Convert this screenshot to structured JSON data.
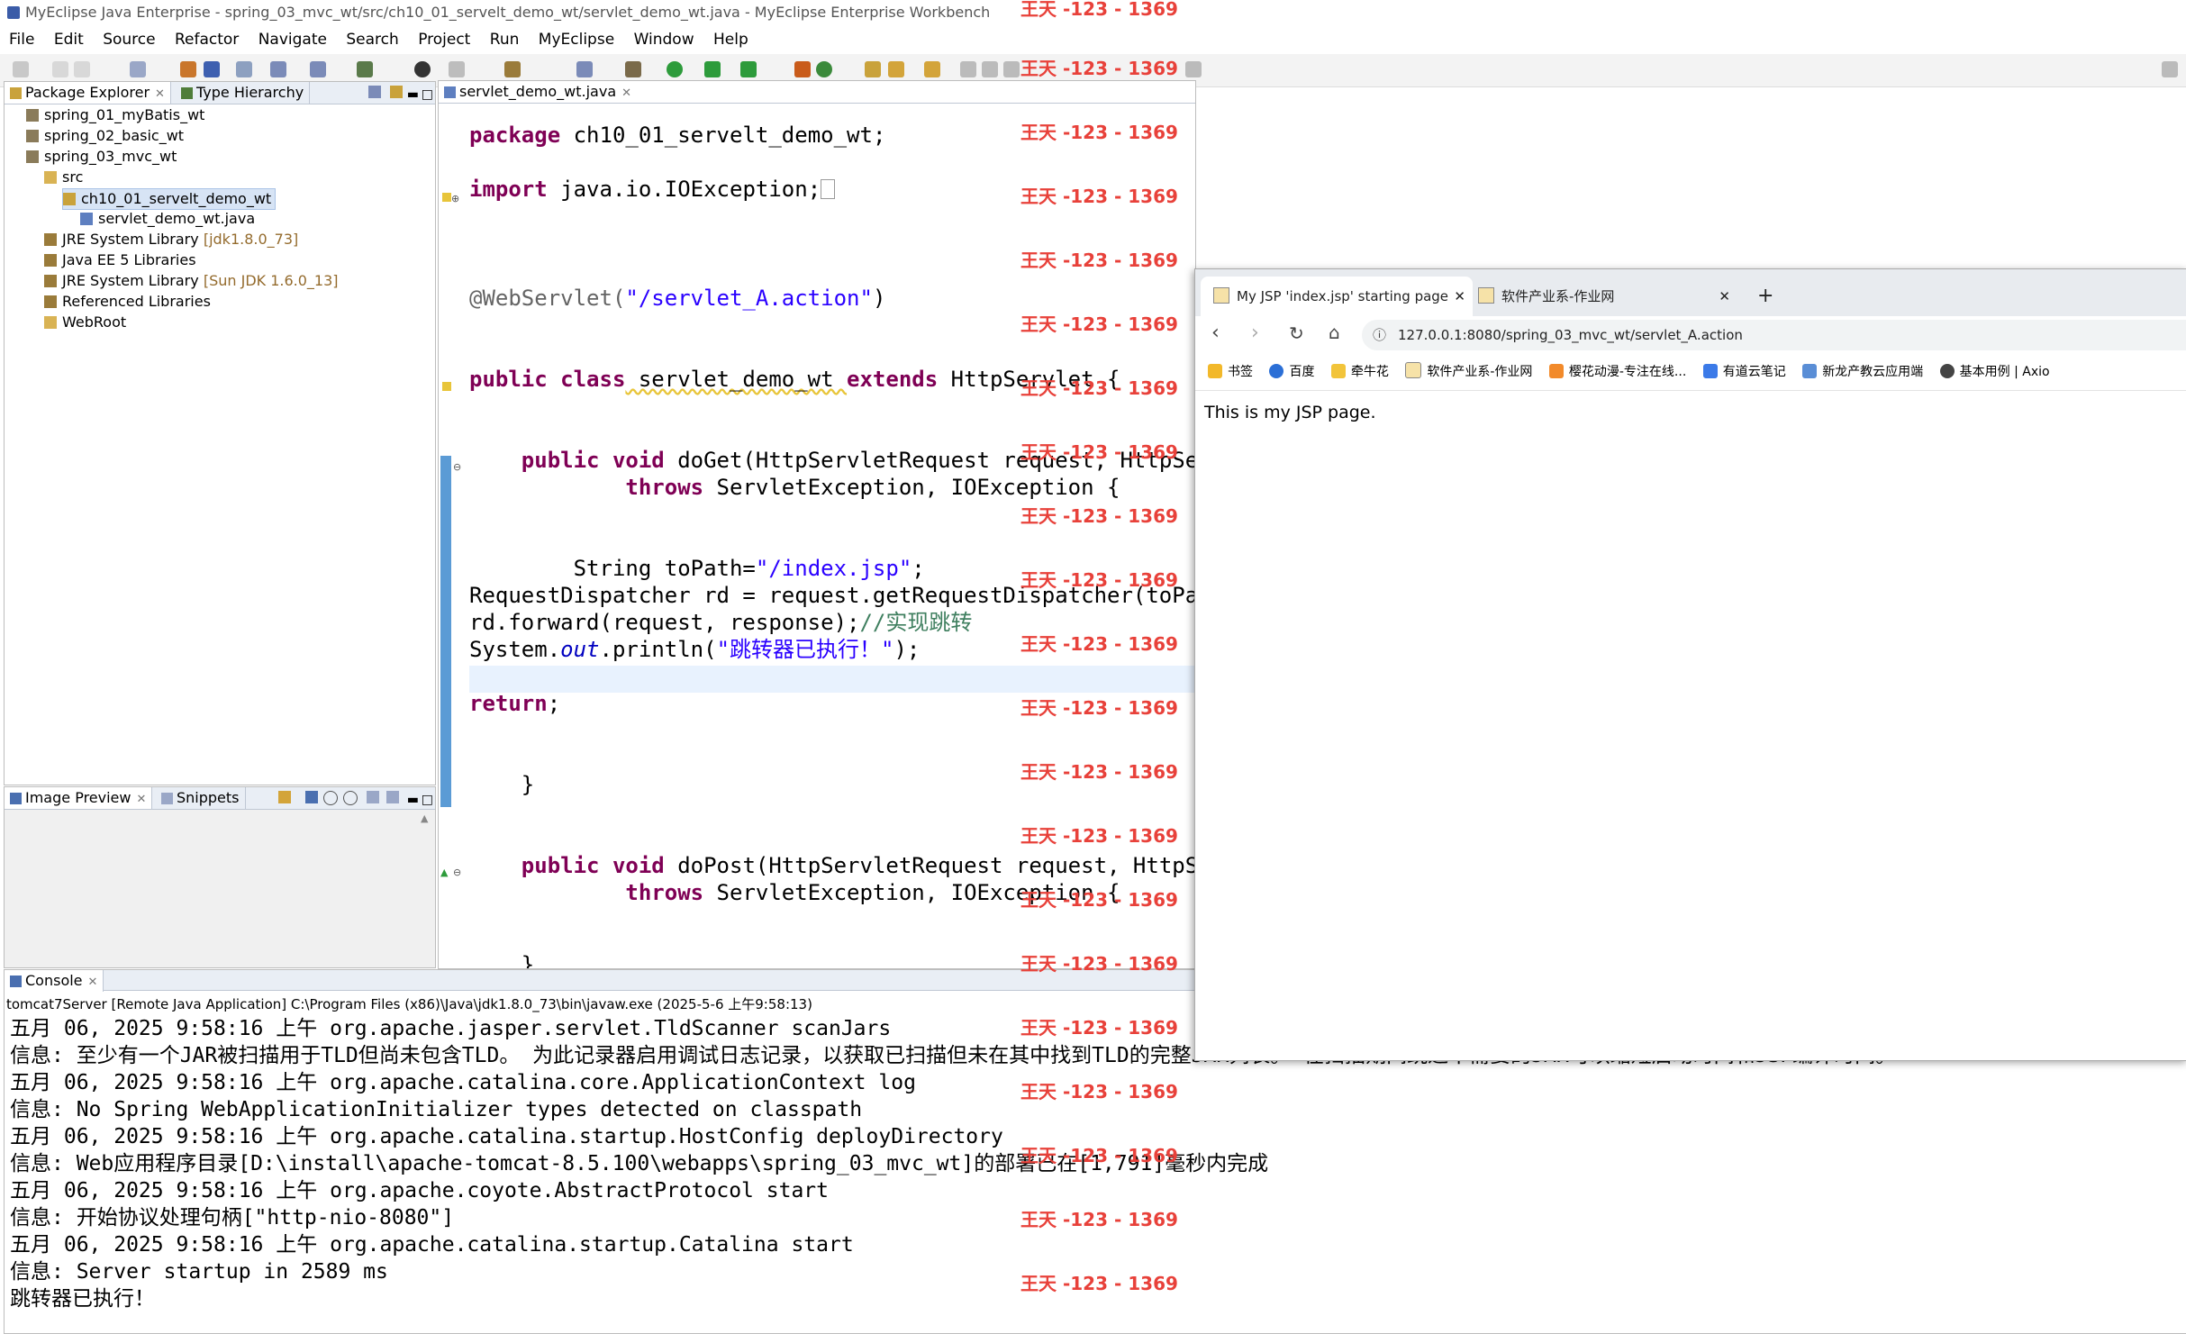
{
  "window": {
    "title": "MyEclipse Java Enterprise - spring_03_mvc_wt/src/ch10_01_servelt_demo_wt/servlet_demo_wt.java - MyEclipse Enterprise Workbench"
  },
  "menu": [
    "File",
    "Edit",
    "Source",
    "Refactor",
    "Navigate",
    "Search",
    "Project",
    "Run",
    "MyEclipse",
    "Window",
    "Help"
  ],
  "package_explorer": {
    "tab_label": "Package Explorer",
    "type_hierarchy_label": "Type Hierarchy",
    "items": [
      {
        "label": "spring_01_myBatis_wt",
        "suffix": ""
      },
      {
        "label": "spring_02_basic_wt",
        "suffix": ""
      },
      {
        "label": "spring_03_mvc_wt",
        "suffix": ""
      },
      {
        "label": "src",
        "suffix": ""
      },
      {
        "label": "ch10_01_servelt_demo_wt",
        "suffix": ""
      },
      {
        "label": "servlet_demo_wt.java",
        "suffix": ""
      },
      {
        "label": "JRE System Library",
        "suffix": "[jdk1.8.0_73]"
      },
      {
        "label": "Java EE 5 Libraries",
        "suffix": ""
      },
      {
        "label": "JRE System Library",
        "suffix": "[Sun JDK 1.6.0_13]"
      },
      {
        "label": "Referenced Libraries",
        "suffix": ""
      },
      {
        "label": "WebRoot",
        "suffix": ""
      }
    ]
  },
  "image_preview": {
    "tab_label": "Image Preview",
    "snippets_label": "Snippets"
  },
  "editor": {
    "tab_label": "servlet_demo_wt.java",
    "lines": {
      "l1a": "package",
      "l1b": " ch10_01_servelt_demo_wt;",
      "l2a": "import",
      "l2b": " java.io.IOException;",
      "l3a": "@WebServlet(",
      "l3b": "\"/servlet_A.action\"",
      "l3c": ")",
      "l4a": "public class",
      "l4b": " servlet_demo_wt ",
      "l4c": "extends",
      "l4d": " HttpServlet {",
      "l5a": "    public void",
      "l5b": " doGet(HttpServletRequest request, HttpServ",
      "l6a": "            throws",
      "l6b": " ServletException, IOException {",
      "l7a": "        String toPath=",
      "l7b": "\"/index.jsp\"",
      "l7c": ";",
      "l8": "RequestDispatcher rd = request.getRequestDispatcher(toPath",
      "l9a": "rd.forward(request, response);",
      "l9b": "//实现跳转",
      "l10a": "System.",
      "l10b": "out",
      "l10c": ".println(",
      "l10d": "\"跳转器已执行！\"",
      "l10e": ");",
      "l11a": "return",
      "l11b": ";",
      "l12": "    }",
      "l13a": "    public void",
      "l13b": " doPost(HttpServletRequest request, HttpSer",
      "l14a": "            throws",
      "l14b": " ServletException, IOException {",
      "l15": "    }"
    }
  },
  "console": {
    "tab_label": "Console",
    "header": "tomcat7Server [Remote Java Application] C:\\Program Files (x86)\\Java\\jdk1.8.0_73\\bin\\javaw.exe (2025-5-6 上午9:58:13)",
    "lines": [
      "五月 06, 2025 9:58:16 上午 org.apache.jasper.servlet.TldScanner scanJars",
      "信息: 至少有一个JAR被扫描用于TLD但尚未包含TLD。 为此记录器启用调试日志记录，以获取已扫描但未在其中找到TLD的完整JAR列表。 在扫描期间跳过不需要的JAR可以缩短启动时间和JSP编译时间。",
      "五月 06, 2025 9:58:16 上午 org.apache.catalina.core.ApplicationContext log",
      "信息: No Spring WebApplicationInitializer types detected on classpath",
      "五月 06, 2025 9:58:16 上午 org.apache.catalina.startup.HostConfig deployDirectory",
      "信息: Web应用程序目录[D:\\install\\apache-tomcat-8.5.100\\webapps\\spring_03_mvc_wt]的部署已在[1,791]毫秒内完成",
      "五月 06, 2025 9:58:16 上午 org.apache.coyote.AbstractProtocol start",
      "信息: 开始协议处理句柄[\"http-nio-8080\"]",
      "五月 06, 2025 9:58:16 上午 org.apache.catalina.startup.Catalina start",
      "信息: Server startup in 2589 ms",
      "跳转器已执行！"
    ]
  },
  "browser": {
    "tabs": [
      {
        "label": "My JSP 'index.jsp' starting page"
      },
      {
        "label": "软件产业系-作业网"
      }
    ],
    "new_tab_label": "+",
    "url": "127.0.0.1:8080/spring_03_mvc_wt/servlet_A.action",
    "bookmarks": [
      "书签",
      "百度",
      "牵牛花",
      "软件产业系-作业网",
      "樱花动漫-专注在线...",
      "有道云笔记",
      "新龙产教云应用端",
      "基本用例 | Axio"
    ],
    "page_text": "This is my JSP page."
  },
  "watermark": "王天 -123 - 1369"
}
